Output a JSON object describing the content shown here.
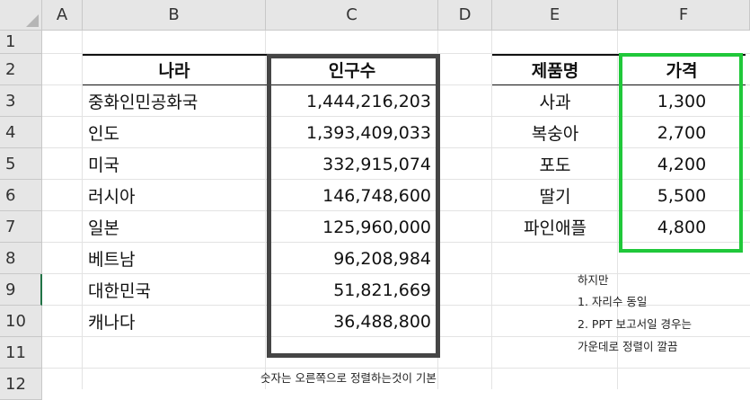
{
  "columns": [
    "A",
    "B",
    "C",
    "D",
    "E",
    "F"
  ],
  "rows": [
    "1",
    "2",
    "3",
    "4",
    "5",
    "6",
    "7",
    "8",
    "9",
    "10",
    "11",
    "12"
  ],
  "population_table": {
    "header_country": "나라",
    "header_population": "인구수",
    "rows": [
      {
        "country": "중화인민공화국",
        "population": "1,444,216,203"
      },
      {
        "country": "인도",
        "population": "1,393,409,033"
      },
      {
        "country": "미국",
        "population": "332,915,074"
      },
      {
        "country": "러시아",
        "population": "146,748,600"
      },
      {
        "country": "일본",
        "population": "125,960,000"
      },
      {
        "country": "베트남",
        "population": "96,208,984"
      },
      {
        "country": "대한민국",
        "population": "51,821,669"
      },
      {
        "country": "캐나다",
        "population": "36,488,800"
      }
    ]
  },
  "product_table": {
    "header_product": "제품명",
    "header_price": "가격",
    "rows": [
      {
        "product": "사과",
        "price": "1,300"
      },
      {
        "product": "복숭아",
        "price": "2,700"
      },
      {
        "product": "포도",
        "price": "4,200"
      },
      {
        "product": "딸기",
        "price": "5,500"
      },
      {
        "product": "파인애플",
        "price": "4,800"
      }
    ]
  },
  "notes": {
    "note_line1": "하지만",
    "note_line2": "1. 자리수 동일",
    "note_line3": "2. PPT 보고서일 경우는",
    "note_line4": "가운데로 정렬이 깔끔",
    "bottom_note": "숫자는 오른쪽으로 정렬하는것이 기본"
  },
  "colors": {
    "highlight_population": "#454545",
    "highlight_price": "#20c83a",
    "header_bg": "#e6e6e6",
    "selected_row_accent": "#217346"
  }
}
